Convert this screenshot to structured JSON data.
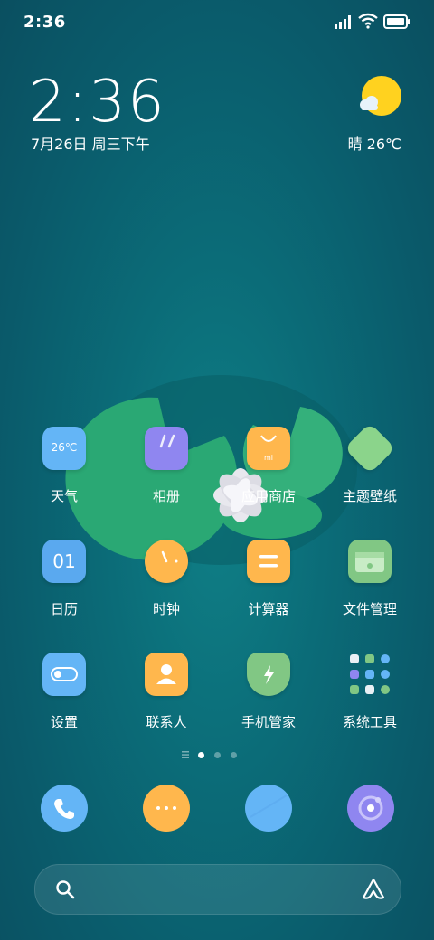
{
  "status_bar": {
    "time": "2:36",
    "icons": [
      "signal-icon",
      "wifi-icon",
      "battery-icon"
    ]
  },
  "clock_widget": {
    "time": "2:36",
    "date": "7月26日 周三下午"
  },
  "weather_widget": {
    "text": "晴 26℃",
    "icon": "sunny-cloud-icon"
  },
  "apps": [
    {
      "label": "天气",
      "icon": "weather-app-icon",
      "badge": "26℃",
      "color": "#64b5f6"
    },
    {
      "label": "相册",
      "icon": "gallery-app-icon",
      "color": "#8f86f0"
    },
    {
      "label": "应用商店",
      "icon": "app-store-icon",
      "badge": "mi",
      "color": "#ffb74d"
    },
    {
      "label": "主题壁纸",
      "icon": "themes-app-icon",
      "color": "#8bd48b"
    },
    {
      "label": "日历",
      "icon": "calendar-app-icon",
      "badge": "01",
      "color": "#5aa9ef"
    },
    {
      "label": "时钟",
      "icon": "clock-app-icon",
      "color": "#ffb74d"
    },
    {
      "label": "计算器",
      "icon": "calculator-app-icon",
      "color": "#ffb74d"
    },
    {
      "label": "文件管理",
      "icon": "file-manager-icon",
      "color": "#81c784"
    },
    {
      "label": "设置",
      "icon": "settings-app-icon",
      "color": "#64b5f6"
    },
    {
      "label": "联系人",
      "icon": "contacts-app-icon",
      "color": "#ffb74d"
    },
    {
      "label": "手机管家",
      "icon": "security-app-icon",
      "color": "#81c784"
    },
    {
      "label": "系统工具",
      "icon": "system-tools-folder-icon",
      "color": "#0e7d88"
    }
  ],
  "page_indicator": {
    "pages": 3,
    "active": 1
  },
  "dock": [
    {
      "icon": "phone-icon",
      "color": "#64b5f6"
    },
    {
      "icon": "messages-icon",
      "color": "#ffb74d"
    },
    {
      "icon": "browser-icon",
      "color": "#64b5f6"
    },
    {
      "icon": "camera-icon",
      "color": "#8f86f0"
    }
  ],
  "search_bar": {
    "left_icon": "search-icon",
    "right_icon": "assistant-icon"
  }
}
